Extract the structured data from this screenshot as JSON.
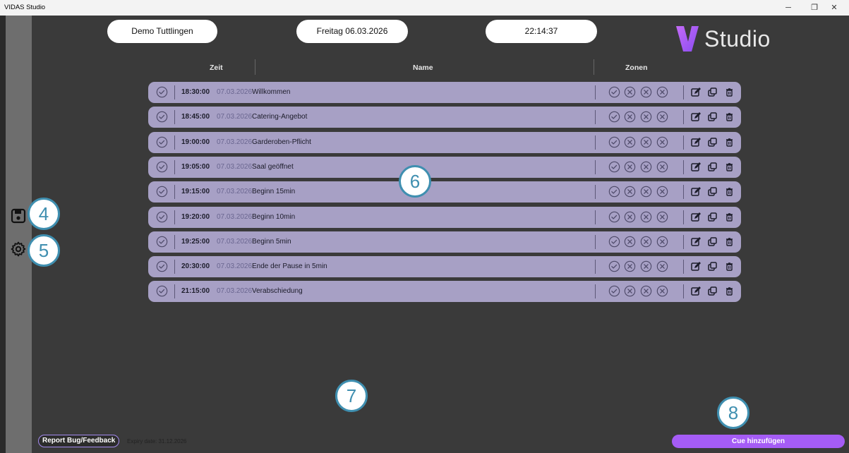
{
  "window": {
    "title": "VIDAS Studio",
    "controls": [
      "minimize-icon",
      "restore-icon",
      "close-icon"
    ]
  },
  "header": {
    "location": "Demo Tuttlingen",
    "date": "Freitag 06.03.2026",
    "clock": "22:14:37",
    "logo_text": "Studio"
  },
  "table": {
    "columns": {
      "time": "Zeit",
      "name": "Name",
      "zones": "Zonen"
    },
    "rows": [
      {
        "time": "18:30:00",
        "date": "07.03.2026",
        "name": "Willkommen"
      },
      {
        "time": "18:45:00",
        "date": "07.03.2026",
        "name": "Catering-Angebot"
      },
      {
        "time": "19:00:00",
        "date": "07.03.2026",
        "name": "Garderoben-Pflicht"
      },
      {
        "time": "19:05:00",
        "date": "07.03.2026",
        "name": "Saal geöffnet"
      },
      {
        "time": "19:15:00",
        "date": "07.03.2026",
        "name": "Beginn 15min"
      },
      {
        "time": "19:20:00",
        "date": "07.03.2026",
        "name": "Beginn 10min"
      },
      {
        "time": "19:25:00",
        "date": "07.03.2026",
        "name": "Beginn 5min"
      },
      {
        "time": "20:30:00",
        "date": "07.03.2026",
        "name": "Ende der Pause in 5min"
      },
      {
        "time": "21:15:00",
        "date": "07.03.2026",
        "name": "Verabschiedung"
      }
    ],
    "zone_states": [
      "check",
      "x",
      "x",
      "x"
    ]
  },
  "annotations": {
    "save": "4",
    "settings": "5",
    "list": "6",
    "empty": "7",
    "add": "8"
  },
  "footer": {
    "report_label": "Report Bug/Feedback",
    "expiry": "Expiry date: 31.12.2026",
    "add_cue_label": "Cue hinzufügen"
  },
  "colors": {
    "row_bg": "#a7a0c5",
    "accent": "#a55cf6",
    "badge": "#3f8fb0"
  }
}
